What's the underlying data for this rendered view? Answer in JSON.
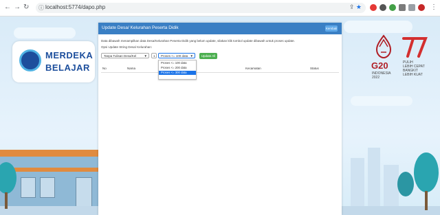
{
  "browser": {
    "url": "localhost:5774/dapo.php"
  },
  "logos": {
    "merdeka_line1": "MERDEKA",
    "merdeka_line2": "BELAJAR",
    "g20": "G20",
    "g20_sub1": "INDONESIA",
    "g20_sub2": "2022",
    "hut_sub1": "PULIH",
    "hut_sub2": "LEBIH CEPAT",
    "hut_sub3": "BANGKIT",
    "hut_sub4": "LEBIH KUAT"
  },
  "panel": {
    "title": "Update Desa/ Kelurahan Peserta Didik",
    "back_label": "Kembali",
    "description": "Data dibawah menampilkan data Desa/Kelurahan Peserta Didik yang belum update, silakan klik tombol update dibawah untuk proses update.",
    "option_label": "Opsi Update String Desa/ Kelurahan:",
    "select1_value": "Tanpa Tulisan Desa/Kel",
    "select2_value": "1",
    "select3_value": "Proses <= 100 data",
    "update_label": "Update All",
    "dropdown_options": [
      "Proses <= 100 data",
      "Proses <= 200 data",
      "Proses <= 300 data"
    ],
    "table_headers": [
      "No",
      "Nama",
      "Kecamatan",
      "Status"
    ]
  },
  "colors": {
    "header": "#3a7fc4",
    "update_button": "#4caf50",
    "selected_option": "#1a73e8"
  }
}
